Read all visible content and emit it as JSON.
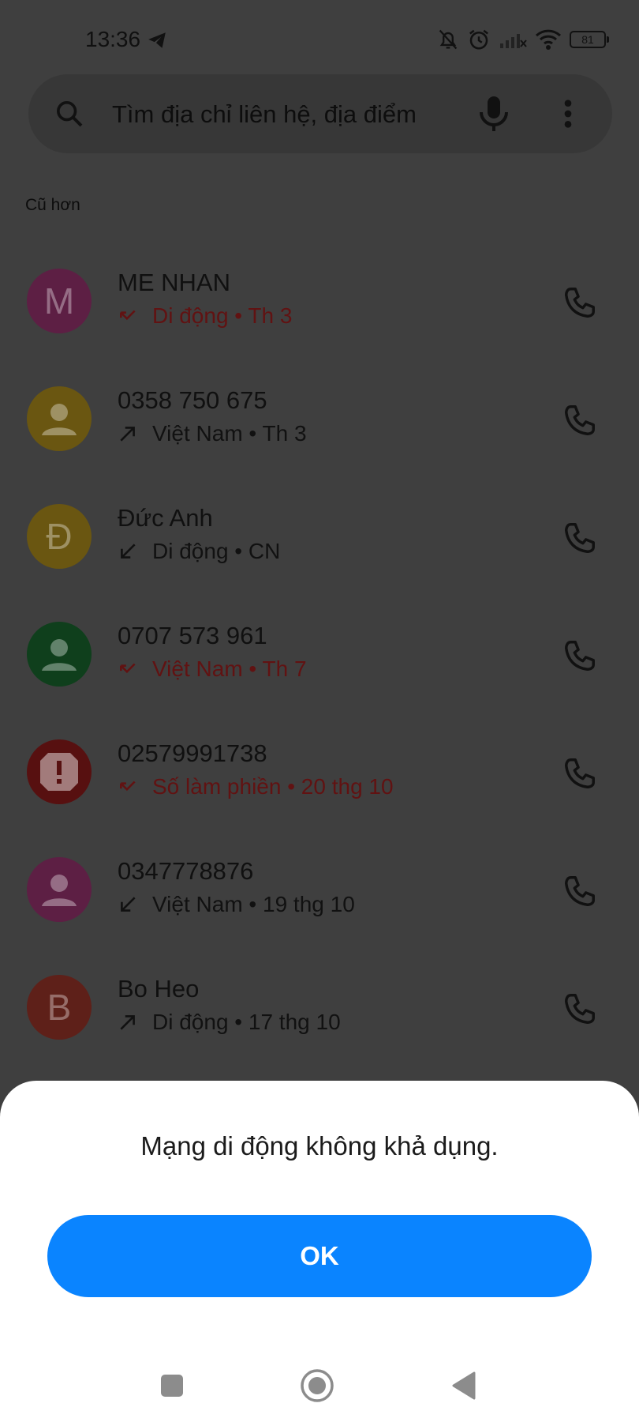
{
  "status_bar": {
    "time": "13:36",
    "battery_level": "81",
    "icons": [
      "telegram-icon",
      "bell-off-icon",
      "alarm-icon",
      "signal-off-icon",
      "wifi-icon",
      "battery-icon"
    ]
  },
  "search": {
    "placeholder": "Tìm địa chỉ liên hệ, địa điểm",
    "icons": [
      "search-icon",
      "mic-icon",
      "more-vert-icon"
    ]
  },
  "section_label": "Cũ hơn",
  "calls": [
    {
      "name": "ME NHAN",
      "avatar_letter": "M",
      "avatar_color": "#5d1f44",
      "direction": "missed",
      "detail": "Di động • Th 3"
    },
    {
      "name": "0358 750 675",
      "avatar_letter": "",
      "avatar_color": "#6a5611",
      "direction": "outgoing",
      "detail": "Việt Nam • Th 3"
    },
    {
      "name": "Đức Anh",
      "avatar_letter": "Đ",
      "avatar_color": "#6a5611",
      "direction": "incoming",
      "detail": "Di động • CN"
    },
    {
      "name": "0707 573 961",
      "avatar_letter": "",
      "avatar_color": "#0f3f1c",
      "direction": "missed",
      "detail": "Việt Nam • Th 7"
    },
    {
      "name": "02579991738",
      "avatar_letter": "!",
      "avatar_color": "#571010",
      "direction": "missed",
      "detail": "Số làm phiền • 20 thg 10"
    },
    {
      "name": "0347778876",
      "avatar_letter": "",
      "avatar_color": "#5d1f44",
      "direction": "incoming",
      "detail": "Việt Nam • 19 thg 10"
    },
    {
      "name": "Bo Heo",
      "avatar_letter": "B",
      "avatar_color": "#5e2019",
      "direction": "outgoing",
      "detail": "Di động • 17 thg 10"
    }
  ],
  "dialog": {
    "message": "Mạng di động không khả dụng.",
    "ok_label": "OK",
    "accent": "#0a84ff"
  },
  "nav_bar": {
    "buttons": [
      "recents-square-icon",
      "home-circle-icon",
      "back-triangle-icon"
    ]
  }
}
